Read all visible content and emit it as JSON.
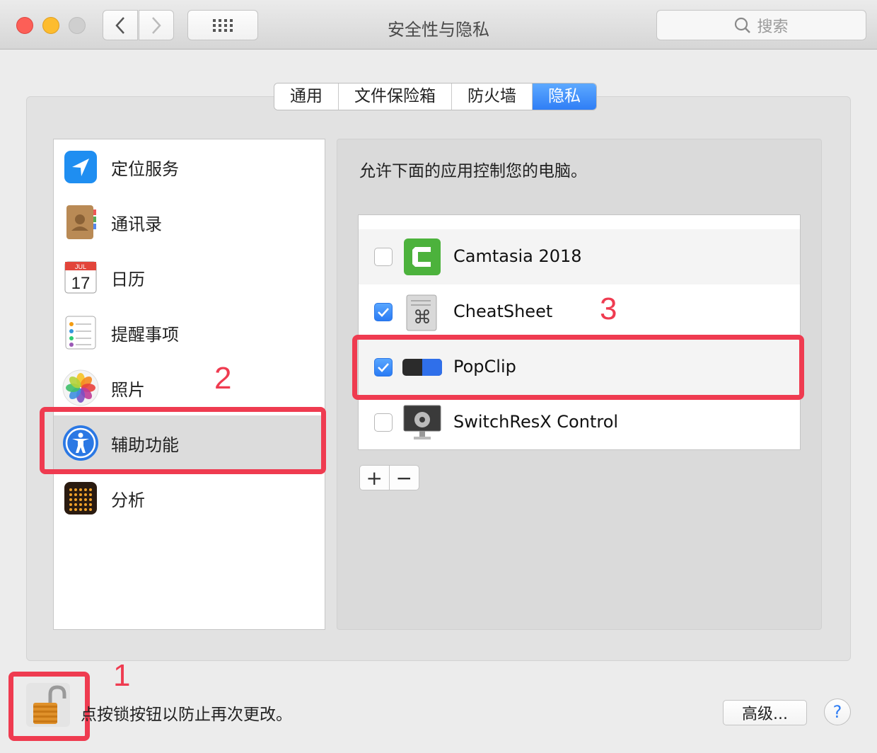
{
  "window": {
    "title": "安全性与隐私"
  },
  "search": {
    "placeholder": "搜索"
  },
  "tabs": [
    {
      "label": "通用",
      "active": false
    },
    {
      "label": "文件保险箱",
      "active": false
    },
    {
      "label": "防火墙",
      "active": false
    },
    {
      "label": "隐私",
      "active": true
    }
  ],
  "sidebar": {
    "items": [
      {
        "label": "定位服务",
        "icon": "location-arrow-icon",
        "selected": false
      },
      {
        "label": "通讯录",
        "icon": "contacts-book-icon",
        "selected": false
      },
      {
        "label": "日历",
        "icon": "calendar-icon",
        "selected": false
      },
      {
        "label": "提醒事项",
        "icon": "reminders-list-icon",
        "selected": false
      },
      {
        "label": "照片",
        "icon": "photos-flower-icon",
        "selected": false
      },
      {
        "label": "辅助功能",
        "icon": "accessibility-person-icon",
        "selected": true
      },
      {
        "label": "分析",
        "icon": "analytics-dots-icon",
        "selected": false
      }
    ]
  },
  "calendar_icon": {
    "month": "JUL",
    "day": "17"
  },
  "pane": {
    "description": "允许下面的应用控制您的电脑。",
    "apps": [
      {
        "name": "Camtasia 2018",
        "checked": false,
        "icon": "camtasia-icon"
      },
      {
        "name": "CheatSheet",
        "checked": true,
        "icon": "cheatsheet-icon"
      },
      {
        "name": "PopClip",
        "checked": true,
        "icon": "popclip-icon"
      },
      {
        "name": "SwitchResX Control",
        "checked": false,
        "icon": "switchresx-icon"
      }
    ],
    "add_label": "+",
    "remove_label": "−"
  },
  "annotations": {
    "one": "1",
    "two": "2",
    "three": "3"
  },
  "footer": {
    "lock_text": "点按锁按钮以防止再次更改。",
    "advanced_label": "高级...",
    "help_label": "?"
  },
  "colors": {
    "accent": "#2f7ef6",
    "annotation": "#ef3b50"
  }
}
